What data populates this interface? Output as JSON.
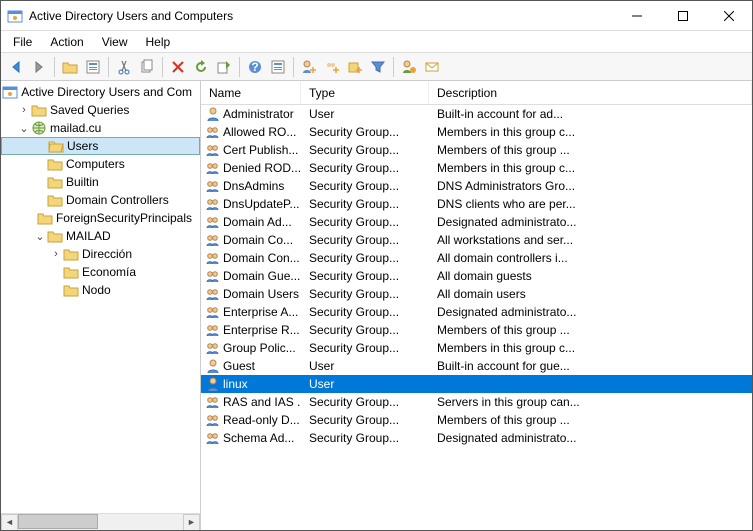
{
  "window": {
    "title": "Active Directory Users and Computers"
  },
  "menu": {
    "file": "File",
    "action": "Action",
    "view": "View",
    "help": "Help"
  },
  "tree": {
    "root": "Active Directory Users and Com",
    "saved": "Saved Queries",
    "domain": "mailad.cu",
    "users": "Users",
    "computers": "Computers",
    "builtin": "Builtin",
    "dc": "Domain Controllers",
    "fsp": "ForeignSecurityPrincipals",
    "mailad": "MAILAD",
    "direccion": "Dirección",
    "economia": "Economía",
    "nodo": "Nodo"
  },
  "columns": {
    "name": "Name",
    "type": "Type",
    "desc": "Description"
  },
  "rows": [
    {
      "icon": "user",
      "name": "Administrator",
      "type": "User",
      "desc": "Built-in account for ad..."
    },
    {
      "icon": "group",
      "name": "Allowed RO...",
      "type": "Security Group...",
      "desc": "Members in this group c..."
    },
    {
      "icon": "group",
      "name": "Cert Publish...",
      "type": "Security Group...",
      "desc": "Members of this group ..."
    },
    {
      "icon": "group",
      "name": "Denied ROD...",
      "type": "Security Group...",
      "desc": "Members in this group c..."
    },
    {
      "icon": "group",
      "name": "DnsAdmins",
      "type": "Security Group...",
      "desc": "DNS Administrators Gro..."
    },
    {
      "icon": "group",
      "name": "DnsUpdateP...",
      "type": "Security Group...",
      "desc": "DNS clients who are per..."
    },
    {
      "icon": "group",
      "name": "Domain Ad...",
      "type": "Security Group...",
      "desc": "Designated administrato..."
    },
    {
      "icon": "group",
      "name": "Domain Co...",
      "type": "Security Group...",
      "desc": "All workstations and ser..."
    },
    {
      "icon": "group",
      "name": "Domain Con...",
      "type": "Security Group...",
      "desc": "All domain controllers i..."
    },
    {
      "icon": "group",
      "name": "Domain Gue...",
      "type": "Security Group...",
      "desc": "All domain guests"
    },
    {
      "icon": "group",
      "name": "Domain Users",
      "type": "Security Group...",
      "desc": "All domain users"
    },
    {
      "icon": "group",
      "name": "Enterprise A...",
      "type": "Security Group...",
      "desc": "Designated administrato..."
    },
    {
      "icon": "group",
      "name": "Enterprise R...",
      "type": "Security Group...",
      "desc": "Members of this group ..."
    },
    {
      "icon": "group",
      "name": "Group Polic...",
      "type": "Security Group...",
      "desc": "Members in this group c..."
    },
    {
      "icon": "user",
      "name": "Guest",
      "type": "User",
      "desc": "Built-in account for gue..."
    },
    {
      "icon": "user",
      "name": "linux",
      "type": "User",
      "desc": "",
      "selected": true
    },
    {
      "icon": "group",
      "name": "RAS and IAS ...",
      "type": "Security Group...",
      "desc": "Servers in this group can..."
    },
    {
      "icon": "group",
      "name": "Read-only D...",
      "type": "Security Group...",
      "desc": "Members of this group ..."
    },
    {
      "icon": "group",
      "name": "Schema Ad...",
      "type": "Security Group...",
      "desc": "Designated administrato..."
    }
  ]
}
